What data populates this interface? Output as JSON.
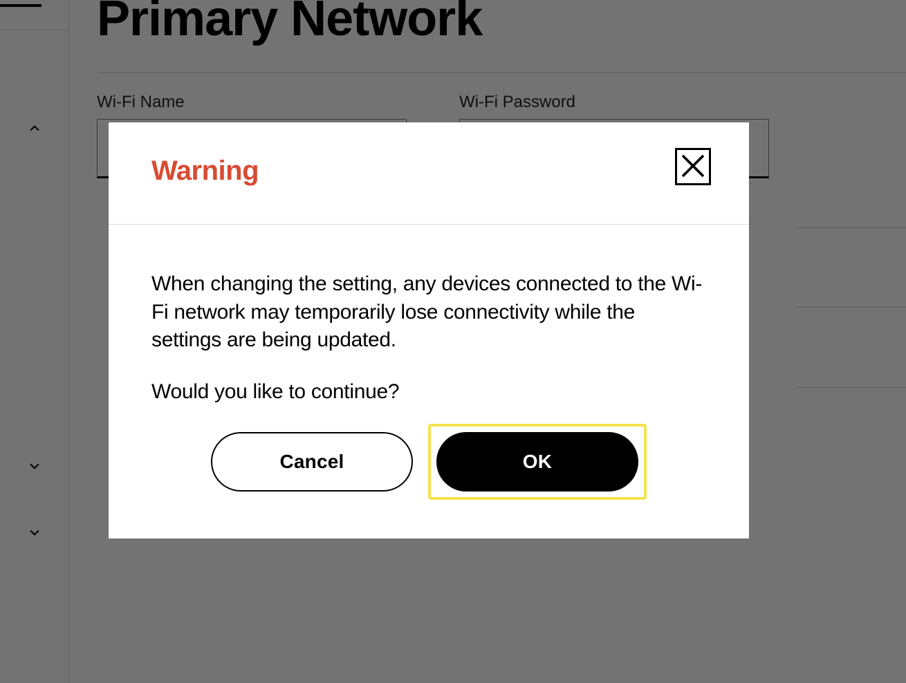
{
  "page": {
    "title": "Primary Network"
  },
  "fields": {
    "wifi_name_label": "Wi-Fi Name",
    "wifi_name_value": "",
    "wifi_password_label": "Wi-Fi Password",
    "wifi_password_value": ""
  },
  "modal": {
    "title": "Warning",
    "body_line1": "When changing the setting, any devices connected to the Wi-Fi network may temporarily lose connectivity while the settings are being updated.",
    "body_line2": "Would you like to continue?",
    "cancel_label": "Cancel",
    "ok_label": "OK"
  },
  "colors": {
    "warning_red": "#d84b33",
    "highlight_yellow": "#f3e24d"
  }
}
